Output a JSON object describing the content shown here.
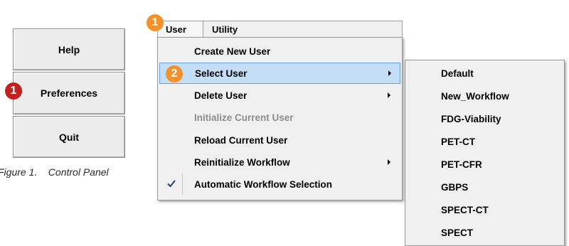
{
  "control_panel": {
    "help_label": "Help",
    "preferences_label": "Preferences",
    "quit_label": "Quit",
    "caption": "Figure 1.    Control Panel"
  },
  "callouts": {
    "preferences_badge": "1",
    "user_menu_badge": "1",
    "select_user_badge": "2",
    "colors": {
      "red": "#c41e1e",
      "orange": "#f2922c"
    }
  },
  "menubar": {
    "tabs": [
      {
        "label": "User"
      },
      {
        "label": "Utility"
      }
    ]
  },
  "user_menu": {
    "items": [
      {
        "label": "Create New User",
        "enabled": true,
        "submenu": false
      },
      {
        "label": "Select User",
        "enabled": true,
        "submenu": true,
        "highlighted": true
      },
      {
        "label": "Delete User",
        "enabled": true,
        "submenu": true
      },
      {
        "label": "Initialize Current User",
        "enabled": false,
        "submenu": false
      },
      {
        "label": "Reload Current User",
        "enabled": true,
        "submenu": false
      },
      {
        "label": "Reinitialize Workflow",
        "enabled": true,
        "submenu": true
      },
      {
        "label": "Automatic Workflow Selection",
        "enabled": true,
        "submenu": false,
        "checked": true
      }
    ],
    "highlight_color": "#c3def6"
  },
  "select_user_submenu": {
    "items": [
      {
        "label": "Default"
      },
      {
        "label": "New_Workflow"
      },
      {
        "label": "FDG-Viability"
      },
      {
        "label": "PET-CT"
      },
      {
        "label": "PET-CFR"
      },
      {
        "label": "GBPS"
      },
      {
        "label": "SPECT-CT"
      },
      {
        "label": "SPECT"
      }
    ]
  }
}
